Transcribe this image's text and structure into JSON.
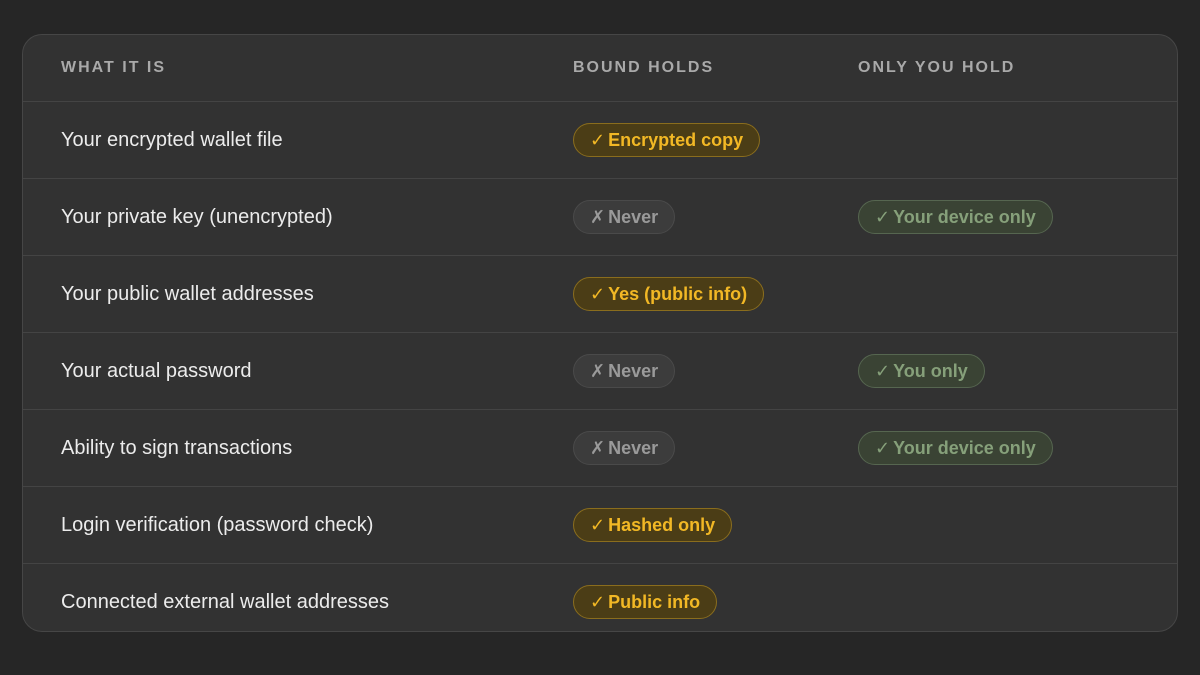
{
  "header": {
    "col1": "WHAT IT IS",
    "col2": "BOUND HOLDS",
    "col3": "ONLY YOU HOLD"
  },
  "icons": {
    "check": "✓",
    "cross": "✗"
  },
  "colors": {
    "yes_text": "#f2b825",
    "never_text": "#9a9a9a",
    "only_text": "#86a07a"
  },
  "rows": [
    {
      "label": "Your encrypted wallet file",
      "bound": "Encrypted copy",
      "only": ""
    },
    {
      "label": "Your private key (unencrypted)",
      "bound": "Never",
      "only": "Your device only"
    },
    {
      "label": "Your public wallet addresses",
      "bound": "Yes (public info)",
      "only": ""
    },
    {
      "label": "Your actual password",
      "bound": "Never",
      "only": "You only"
    },
    {
      "label": "Ability to sign transactions",
      "bound": "Never",
      "only": "Your device only"
    },
    {
      "label": "Login verification (password check)",
      "bound": "Hashed only",
      "only": ""
    },
    {
      "label": "Connected external wallet addresses",
      "bound": "Public info",
      "only": ""
    }
  ]
}
